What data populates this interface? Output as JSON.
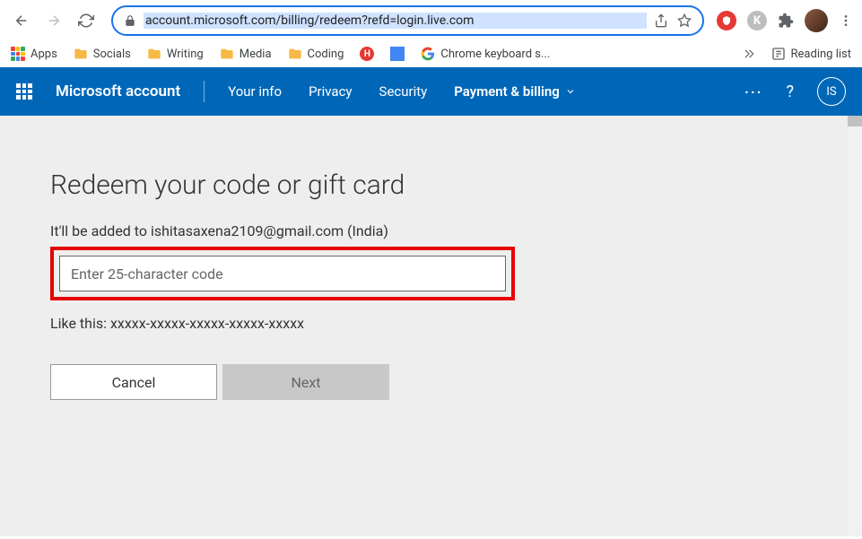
{
  "browser": {
    "url": "account.microsoft.com/billing/redeem?refd=login.live.com"
  },
  "bookmarks": {
    "apps": "Apps",
    "socials": "Socials",
    "writing": "Writing",
    "media": "Media",
    "coding": "Coding",
    "chrome_keyboard": "Chrome keyboard s...",
    "reading_list": "Reading list"
  },
  "header": {
    "title": "Microsoft account",
    "nav": {
      "your_info": "Your info",
      "privacy": "Privacy",
      "security": "Security",
      "payment_billing": "Payment & billing"
    },
    "help": "?",
    "user_initials": "IS"
  },
  "page": {
    "heading": "Redeem your code or gift card",
    "subtext": "It'll be added to ishitasaxena2109@gmail.com (India)",
    "input_placeholder": "Enter 25-character code",
    "hint": "Like this: xxxxx-xxxxx-xxxxx-xxxxx-xxxxx",
    "cancel": "Cancel",
    "next": "Next"
  }
}
